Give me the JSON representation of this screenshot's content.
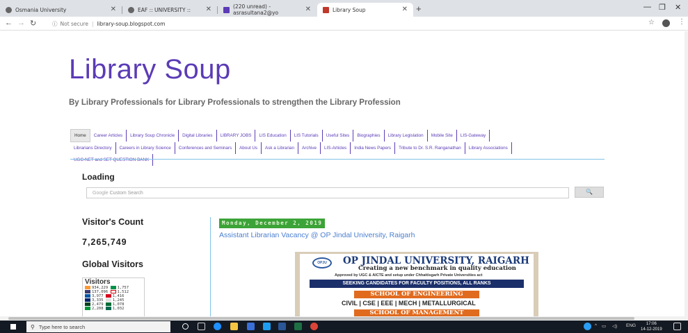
{
  "browser": {
    "tabs": [
      {
        "label": "Osmania University",
        "icon": "globe-icon",
        "color": "#666666"
      },
      {
        "label": "EAF :: UNIVERSITY ::",
        "icon": "globe-icon",
        "color": "#666666"
      },
      {
        "label": "(220 unread) - asrasultana2@yo",
        "icon": "mail-icon",
        "color": "#5b3bb6"
      },
      {
        "label": "Library Soup",
        "icon": "library-soup-favicon",
        "color": "#c0392b"
      }
    ],
    "new_tab": "+",
    "url_info": "ⓘ",
    "not_secure": "Not secure",
    "url": "library-soup.blogspot.com"
  },
  "site": {
    "title": "Library Soup",
    "description": "By Library Professionals for Library Professionals to strengthen the Library Profession",
    "accent_color": "#5b3bb6"
  },
  "nav": [
    "Home",
    "Career Articles",
    "Library Soup Chronicle",
    "Digital Libraries",
    "LIBRARY JOBS",
    "LIS Education",
    "LIS Tutorials",
    "Useful Sites",
    "Biographies",
    "Library Legislation",
    "Mobile Site",
    "LIS-Gateway",
    "Librarians Directory",
    "Careers in Library Science",
    "Conferences and Seminars",
    "About Us",
    "Ask a Librarian",
    "Archive",
    "LIS-Articles",
    "India News Papers",
    "Tribute to Dr. S.R. Ranganathan",
    "Library Associations",
    "UGC-NET and SET QUESTION BANK"
  ],
  "search": {
    "heading": "Loading",
    "google": "Google",
    "placeholder": "Custom Search",
    "button": "🔍"
  },
  "sidebar": {
    "visitors_heading": "Visitor's Count",
    "visitors_count": "7,265,749",
    "global_heading": "Global Visitors",
    "flag_title": "Visitors",
    "flag_rows": [
      {
        "a": "934,229",
        "b": "1,757"
      },
      {
        "a": "137,096",
        "b": "1,512"
      },
      {
        "a": "3,977",
        "b": "1,416"
      },
      {
        "a": "3,335",
        "b": "1,245"
      },
      {
        "a": "2,479",
        "b": "1,078"
      },
      {
        "a": "2,208",
        "b": "1,032"
      }
    ]
  },
  "post": {
    "date": "Monday, December 2, 2019",
    "title": "Assistant Librarian Vacancy @ OP Jindal University, Raigarh",
    "poster": {
      "logo": "OPJU",
      "university": "OP JINDAL UNIVERSITY, RAIGARH",
      "tagline": "Creating a new benchmark in quality education",
      "approved": "Approved by UGC & AICTE and setup under Chhattisgarh Private Universities act",
      "band": "SEEKING CANDIDATES FOR FACULTY POSITIONS, ALL RANKS",
      "school_eng": "SCHOOL OF ENGINEERING",
      "branches": "CIVIL | CSE | EEE | MECH | METALLURGICAL",
      "school_mgmt": "SCHOOL OF MANAGEMENT"
    }
  },
  "taskbar": {
    "search_placeholder": "Type here to search",
    "lang": "ENG",
    "time": "17:06",
    "date": "14-12-2019"
  }
}
